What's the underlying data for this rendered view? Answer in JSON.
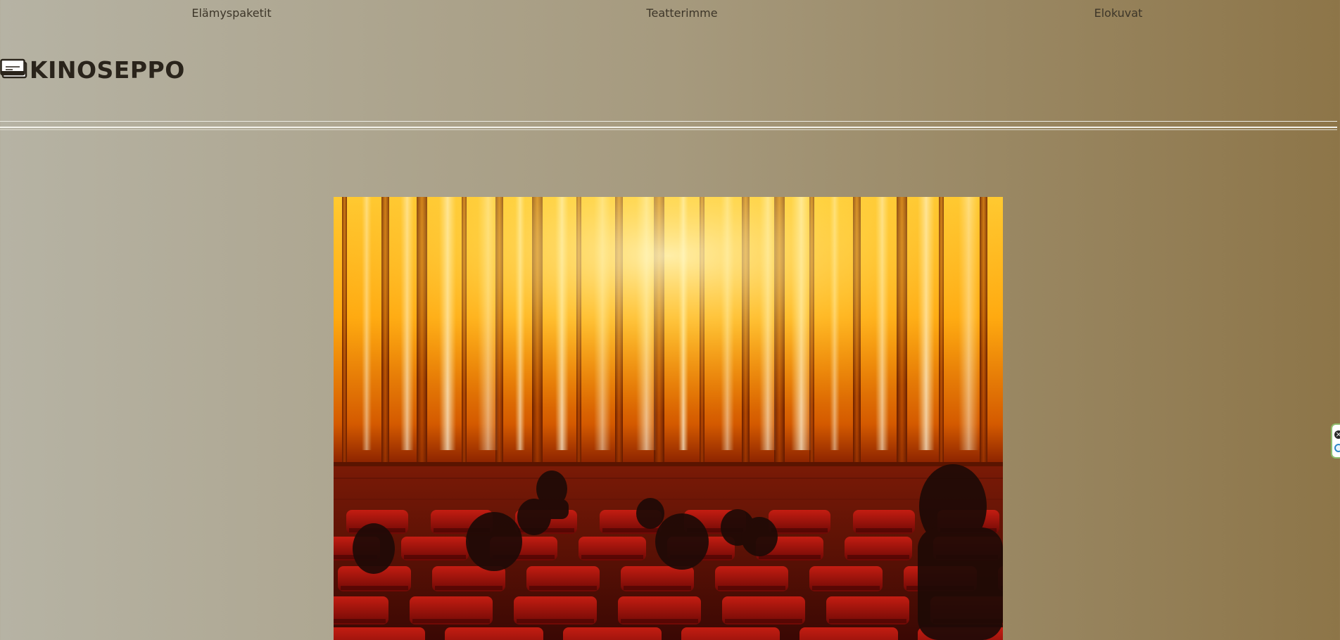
{
  "nav": {
    "items": [
      {
        "label": "Elämyspaketit"
      },
      {
        "label": "Teatterimme"
      },
      {
        "label": "Elokuvat"
      }
    ]
  },
  "brand": {
    "name": "KINOSEPPO",
    "icon": "ticket-icon"
  },
  "hero": {
    "image": "cinema-auditorium-curtain-photo"
  },
  "widget": {
    "close_icon": "close-icon",
    "open_icon": "circle-icon"
  },
  "colors": {
    "background_left": "#b6b3a4",
    "background_right": "#8d7548",
    "text": "#2a241b",
    "seat_red": "#a0150d",
    "curtain_gold": "#ffb300"
  }
}
